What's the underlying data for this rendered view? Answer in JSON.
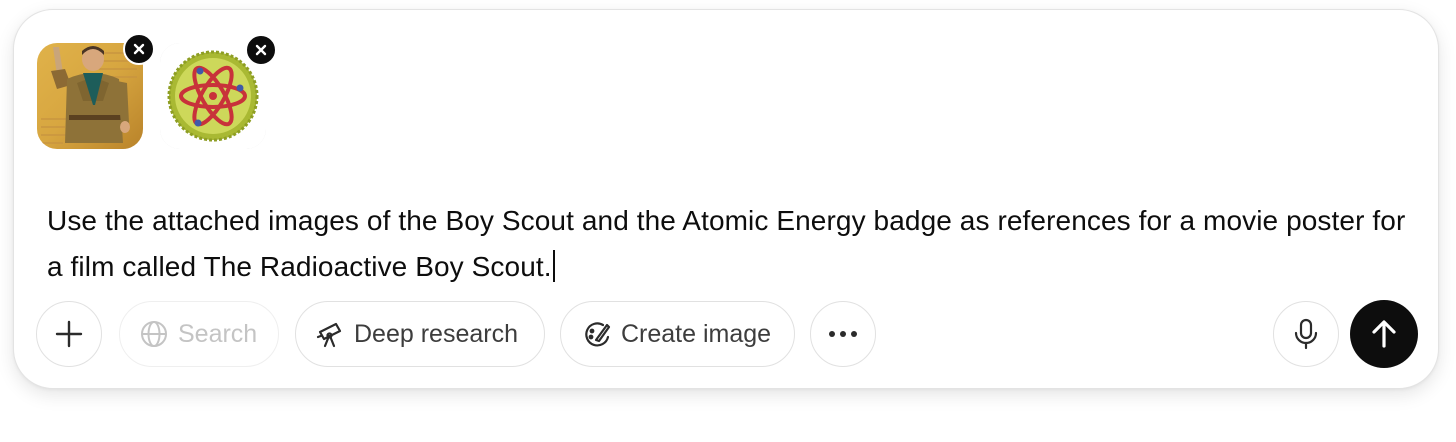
{
  "composer": {
    "attachments": [
      {
        "alt": "Boy Scout illustration",
        "icon": "scout-illustration"
      },
      {
        "alt": "Atomic Energy merit badge",
        "icon": "atom-badge"
      }
    ],
    "prompt_text": "Use the attached images of the Boy Scout and the Atomic Energy badge as references for a movie poster for a film called The Radioactive Boy Scout."
  },
  "toolbar": {
    "add_icon": "plus-icon",
    "search_label": "Search",
    "search_icon": "globe-icon",
    "deep_research_label": "Deep research",
    "deep_research_icon": "telescope-icon",
    "create_image_label": "Create image",
    "create_image_icon": "palette-icon",
    "more_icon": "ellipsis-icon",
    "mic_icon": "microphone-icon",
    "send_icon": "arrow-up-icon"
  },
  "colors": {
    "send_button_bg": "#0d0d0d",
    "text": "#0d0d0d",
    "disabled_text": "#c4c4c4",
    "border": "#e1e1e1"
  }
}
